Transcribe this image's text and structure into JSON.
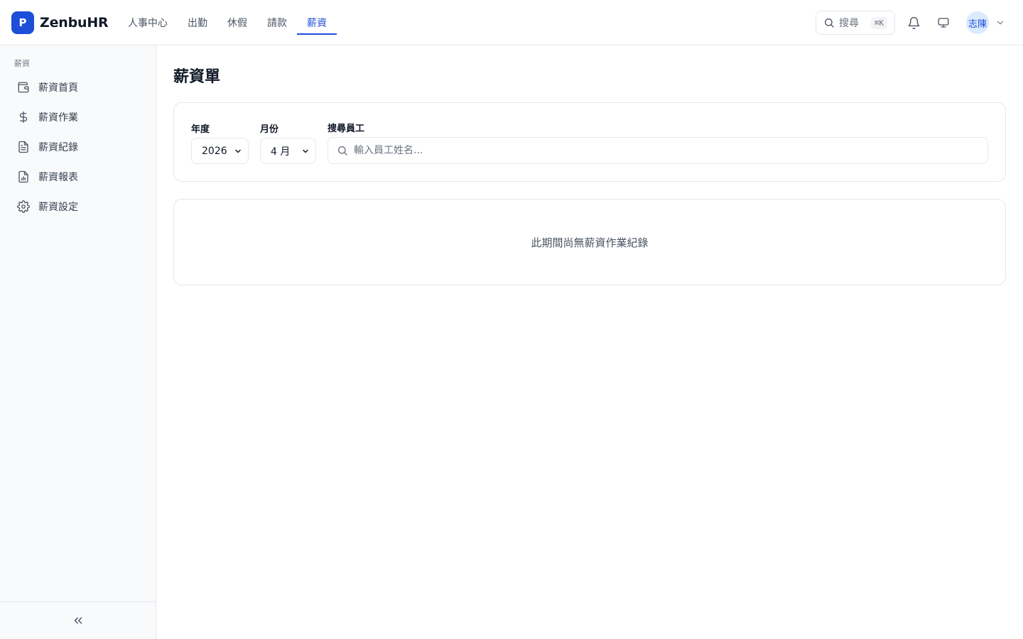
{
  "app": {
    "logo_letter": "P",
    "name": "ZenbuHR",
    "brand_color": "#1d4ed8"
  },
  "nav": {
    "items": [
      {
        "label": "人事中心"
      },
      {
        "label": "出勤"
      },
      {
        "label": "休假"
      },
      {
        "label": "請款"
      },
      {
        "label": "薪資",
        "active": true
      }
    ]
  },
  "header": {
    "search_label": "搜尋",
    "search_shortcut": "⌘K",
    "icons": [
      "search-icon",
      "bell-icon",
      "monitor-icon",
      "chevron-down-icon"
    ],
    "user_avatar": "志陳"
  },
  "sidebar": {
    "section_title": "薪資",
    "items": [
      {
        "label": "薪資首頁",
        "icon": "wallet-icon"
      },
      {
        "label": "薪資作業",
        "icon": "dollar-icon"
      },
      {
        "label": "薪資紀錄",
        "icon": "file-text-icon"
      },
      {
        "label": "薪資報表",
        "icon": "file-chart-icon"
      },
      {
        "label": "薪資設定",
        "icon": "gear-icon"
      }
    ],
    "collapse_icon": "chevrons-left-icon"
  },
  "main": {
    "title": "薪資單",
    "filters": {
      "year_label": "年度",
      "year_value": "2026",
      "month_label": "月份",
      "month_value": "4 月",
      "search_label": "搜尋員工",
      "search_placeholder": "輸入員工姓名..."
    },
    "empty_message": "此期間尚無薪資作業紀錄"
  }
}
